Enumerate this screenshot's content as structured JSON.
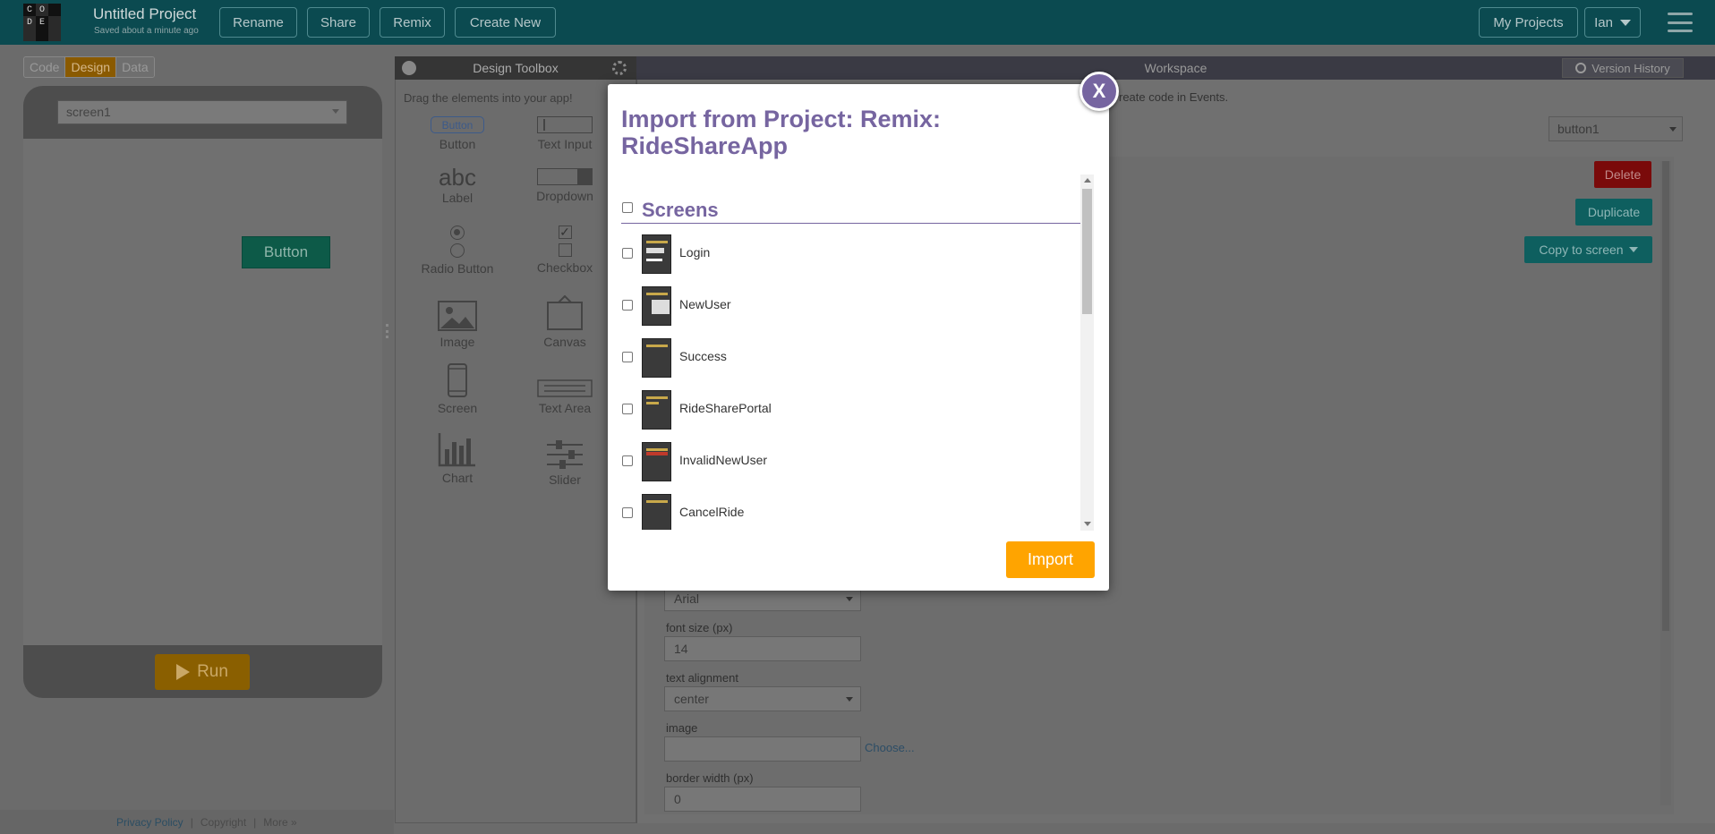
{
  "header": {
    "logo_letters": [
      "C",
      "O",
      "",
      "D",
      "E",
      "",
      "",
      "",
      ""
    ],
    "project_name": "Untitled Project",
    "saved_status": "Saved about a minute ago",
    "buttons": {
      "rename": "Rename",
      "share": "Share",
      "remix": "Remix",
      "create_new": "Create New"
    },
    "my_projects": "My Projects",
    "user": "Ian"
  },
  "left_panel": {
    "modes": [
      "Code",
      "Design",
      "Data"
    ],
    "active_mode": "Design",
    "screen_select": "screen1",
    "app_button_label": "Button",
    "run_label": "Run"
  },
  "footer": {
    "privacy": "Privacy Policy",
    "copyright": "Copyright",
    "more": "More »"
  },
  "toolbox": {
    "title": "Design Toolbox",
    "hint": "Drag the elements into your app!",
    "tools": [
      {
        "label": "Button",
        "icon": "button-icon"
      },
      {
        "label": "Text Input",
        "icon": "text-input-icon"
      },
      {
        "label": "Label",
        "icon": "label-icon"
      },
      {
        "label": "Dropdown",
        "icon": "dropdown-icon"
      },
      {
        "label": "Radio Button",
        "icon": "radio-button-icon"
      },
      {
        "label": "Checkbox",
        "icon": "checkbox-icon"
      },
      {
        "label": "Image",
        "icon": "image-icon"
      },
      {
        "label": "Canvas",
        "icon": "canvas-icon"
      },
      {
        "label": "Screen",
        "icon": "screen-icon"
      },
      {
        "label": "Text Area",
        "icon": "text-area-icon"
      },
      {
        "label": "Chart",
        "icon": "chart-icon"
      },
      {
        "label": "Slider",
        "icon": "slider-icon"
      }
    ],
    "button_icon_text": "Button",
    "label_icon_text": "abc"
  },
  "workspace": {
    "title": "Workspace",
    "version_history": "Version History",
    "hint": "reate code in Events.",
    "element_select": "button1",
    "delete": "Delete",
    "duplicate": "Duplicate",
    "copy_to_screen": "Copy to screen",
    "font_family_value": "Arial",
    "font_size_label": "font size (px)",
    "font_size_value": "14",
    "text_alignment_label": "text alignment",
    "text_alignment_value": "center",
    "image_label": "image",
    "image_value": "",
    "choose": "Choose...",
    "border_width_label": "border width (px)",
    "border_width_value": "0"
  },
  "modal": {
    "close_label": "X",
    "title": "Import from Project: Remix: RideShareApp",
    "section_title": "Screens",
    "items": [
      "Login",
      "NewUser",
      "Success",
      "RideSharePortal",
      "InvalidNewUser",
      "CancelRide"
    ],
    "import_label": "Import"
  },
  "colors": {
    "header_bg": "#0b4a50",
    "modal_accent": "#7665a0",
    "import_button": "#ffa400",
    "delete_button": "#8b0000",
    "teal_button": "#0d5a5a"
  }
}
